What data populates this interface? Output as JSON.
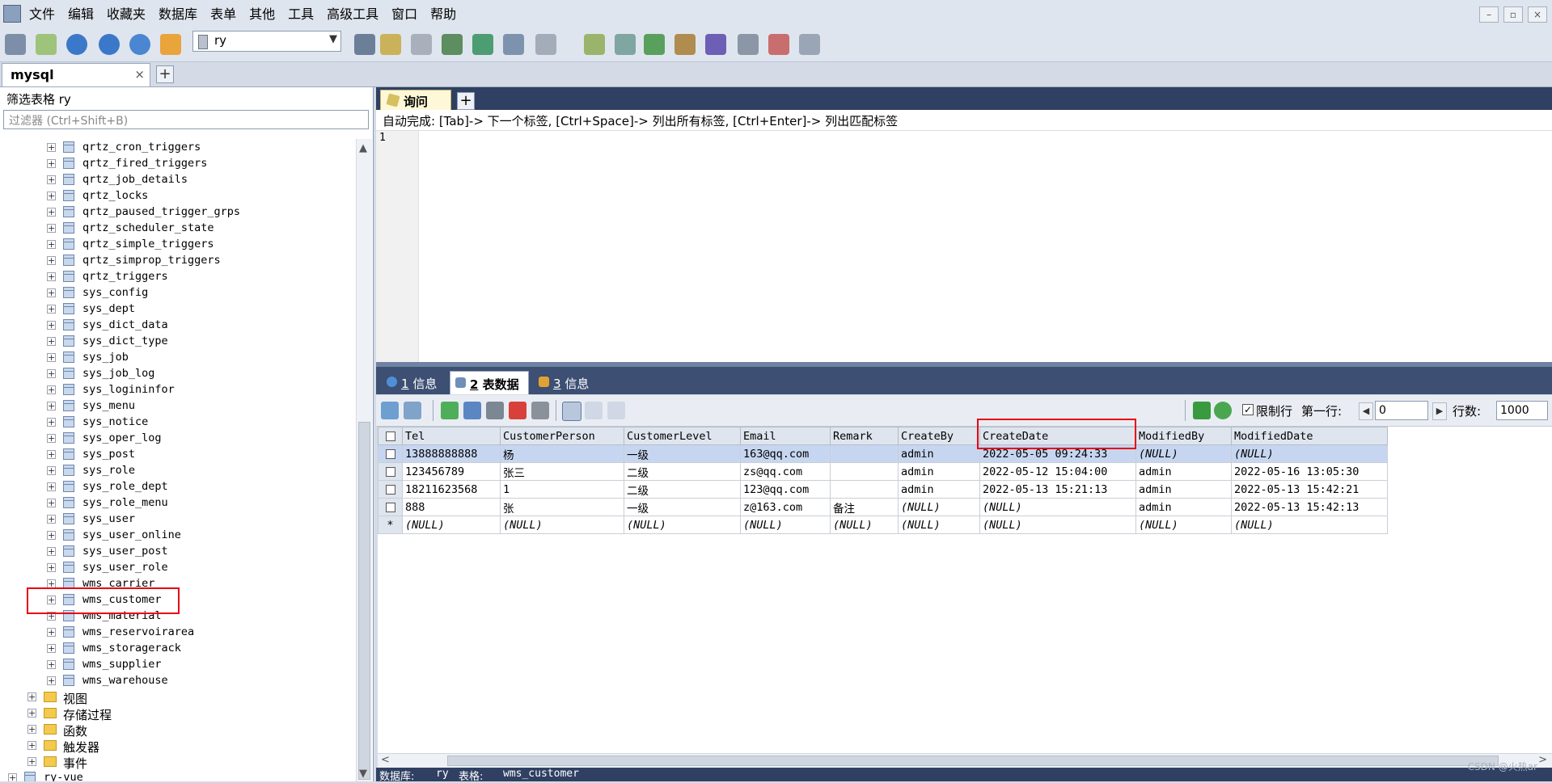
{
  "menu": [
    "文件",
    "编辑",
    "收藏夹",
    "数据库",
    "表单",
    "其他",
    "工具",
    "高级工具",
    "窗口",
    "帮助"
  ],
  "toolbar": {
    "db_selected": "ry"
  },
  "connection_tab": {
    "label": "mysql",
    "close": "×",
    "add": "+"
  },
  "left": {
    "filter_label": "筛选表格 ry",
    "filter_placeholder": "过滤器 (Ctrl+Shift+B)",
    "tables": [
      "qrtz_cron_triggers",
      "qrtz_fired_triggers",
      "qrtz_job_details",
      "qrtz_locks",
      "qrtz_paused_trigger_grps",
      "qrtz_scheduler_state",
      "qrtz_simple_triggers",
      "qrtz_simprop_triggers",
      "qrtz_triggers",
      "sys_config",
      "sys_dept",
      "sys_dict_data",
      "sys_dict_type",
      "sys_job",
      "sys_job_log",
      "sys_logininfor",
      "sys_menu",
      "sys_notice",
      "sys_oper_log",
      "sys_post",
      "sys_role",
      "sys_role_dept",
      "sys_role_menu",
      "sys_user",
      "sys_user_online",
      "sys_user_post",
      "sys_user_role",
      "wms_carrier",
      "wms_customer",
      "wms_material",
      "wms_reservoirarea",
      "wms_storagerack",
      "wms_supplier",
      "wms_warehouse"
    ],
    "folders": [
      "视图",
      "存储过程",
      "函数",
      "触发器",
      "事件"
    ],
    "next_db": "ry-vue"
  },
  "query": {
    "tab_label": "询问",
    "autocomplete": "自动完成: [Tab]-> 下一个标签, [Ctrl+Space]-> 列出所有标签, [Ctrl+Enter]-> 列出匹配标签",
    "line_number": "1"
  },
  "result_tabs": [
    {
      "num": "1",
      "label": "信息"
    },
    {
      "num": "2",
      "label": "表数据"
    },
    {
      "num": "3",
      "label": "信息"
    }
  ],
  "gridbar": {
    "limit_label": "限制行",
    "first_row_label": "第一行:",
    "first_row_value": "0",
    "rows_label": "行数:",
    "rows_value": "1000"
  },
  "grid": {
    "columns": [
      "Tel",
      "CustomerPerson",
      "CustomerLevel",
      "Email",
      "Remark",
      "CreateBy",
      "CreateDate",
      "ModifiedBy",
      "ModifiedDate"
    ],
    "rows": [
      [
        "13888888888",
        "杨",
        "一级",
        "163@qq.com",
        "",
        "admin",
        "2022-05-05 09:24:33",
        "(NULL)",
        "(NULL)"
      ],
      [
        "123456789",
        "张三",
        "二级",
        "zs@qq.com",
        "",
        "admin",
        "2022-05-12 15:04:00",
        "admin",
        "2022-05-16 13:05:30"
      ],
      [
        "18211623568",
        "1",
        "二级",
        "123@qq.com",
        "",
        "admin",
        "2022-05-13 15:21:13",
        "admin",
        "2022-05-13 15:42:21"
      ],
      [
        "888",
        "张",
        "一级",
        "z@163.com",
        "备注",
        "(NULL)",
        "(NULL)",
        "admin",
        "2022-05-13 15:42:13"
      ],
      [
        "(NULL)",
        "(NULL)",
        "(NULL)",
        "(NULL)",
        "(NULL)",
        "(NULL)",
        "(NULL)",
        "(NULL)",
        "(NULL)"
      ]
    ],
    "new_row_marker": "*"
  },
  "status": {
    "db_label": "数据库:",
    "db_value": "ry",
    "table_label": "表格:",
    "table_value": "wms_customer"
  },
  "watermark": "CSDN @火热ar",
  "colors": {
    "highlight": "#e60012",
    "selected_row": "#c7d6f0",
    "dark_strip": "#2f4063"
  }
}
